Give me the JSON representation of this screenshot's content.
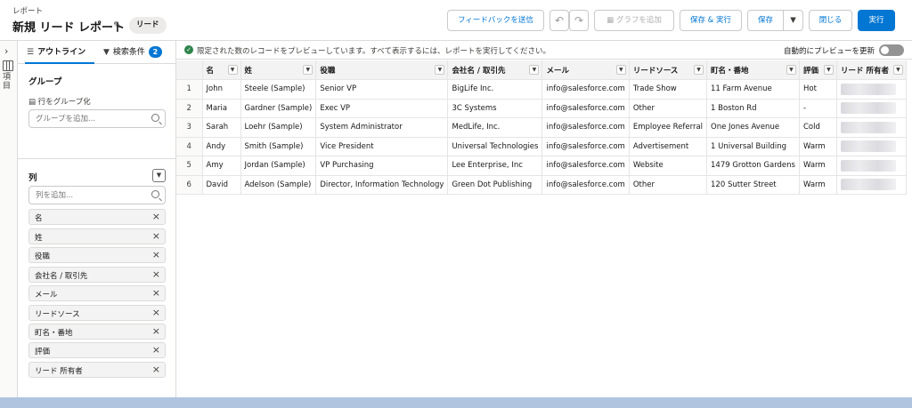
{
  "header": {
    "subtitle": "レポート",
    "title": "新規 リード レポート",
    "report_type_badge": "リード",
    "buttons": {
      "feedback": "フィードバックを送信",
      "add_chart": "グラフを追加",
      "save_run": "保存 & 実行",
      "save": "保存",
      "close": "閉じる",
      "run": "実行"
    }
  },
  "rail": {
    "label": "項目"
  },
  "panel": {
    "tabs": {
      "outline": "アウトライン",
      "filters": "検索条件",
      "filters_count": "2"
    },
    "groups": {
      "title": "グループ",
      "group_rows_label": "行をグループ化",
      "add_group_placeholder": "グループを追加..."
    },
    "columns": {
      "title": "列",
      "add_column_placeholder": "列を追加...",
      "items": [
        "名",
        "姓",
        "役職",
        "会社名 / 取引先",
        "メール",
        "リードソース",
        "町名・番地",
        "評価",
        "リード 所有者"
      ]
    }
  },
  "main": {
    "notice": "限定された数のレコードをプレビューしています。すべて表示するには、レポートを実行してください。",
    "auto_preview_label": "自動的にプレビューを更新",
    "table": {
      "headers": [
        "名",
        "姓",
        "役職",
        "会社名 / 取引先",
        "メール",
        "リードソース",
        "町名・番地",
        "評価",
        "リード 所有者"
      ],
      "rows": [
        [
          "1",
          "John",
          "Steele (Sample)",
          "Senior VP",
          "BigLife Inc.",
          "info@salesforce.com",
          "Trade Show",
          "11 Farm Avenue",
          "Hot"
        ],
        [
          "2",
          "Maria",
          "Gardner (Sample)",
          "Exec VP",
          "3C Systems",
          "info@salesforce.com",
          "Other",
          "1 Boston Rd",
          "-"
        ],
        [
          "3",
          "Sarah",
          "Loehr (Sample)",
          "System Administrator",
          "MedLife, Inc.",
          "info@salesforce.com",
          "Employee Referral",
          "One Jones Avenue",
          "Cold"
        ],
        [
          "4",
          "Andy",
          "Smith (Sample)",
          "Vice President",
          "Universal Technologies",
          "info@salesforce.com",
          "Advertisement",
          "1 Universal Building",
          "Warm"
        ],
        [
          "5",
          "Amy",
          "Jordan (Sample)",
          "VP Purchasing",
          "Lee Enterprise, Inc",
          "info@salesforce.com",
          "Website",
          "1479 Grotton Gardens",
          "Warm"
        ],
        [
          "6",
          "David",
          "Adelson (Sample)",
          "Director, Information Technology",
          "Green Dot Publishing",
          "info@salesforce.com",
          "Other",
          "120 Sutter Street",
          "Warm"
        ]
      ]
    }
  },
  "colors": {
    "brand": "#0176d3",
    "success": "#2e844a",
    "footer": "#b0c4df"
  }
}
